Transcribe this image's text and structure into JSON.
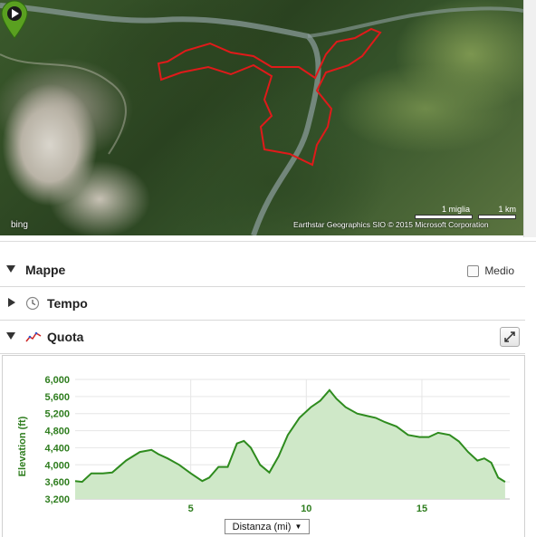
{
  "map": {
    "attribution": "Earthstar Geographics SIO   © 2015 Microsoft Corporation",
    "bing_logo": "bing",
    "scale_mi": "1 miglia",
    "scale_km": "1 km",
    "route_color": "#e01a1a",
    "marker_color": "#5aa020",
    "marker_icon": "play-icon"
  },
  "panels": {
    "mappe": {
      "title": "Mappe",
      "checkbox_label": "Medio",
      "checked": false
    },
    "tempo": {
      "title": "Tempo",
      "icon": "clock-icon"
    },
    "quota": {
      "title": "Quota",
      "icon": "elevation-chart-icon"
    }
  },
  "chart_data": {
    "type": "area",
    "ylabel": "Elevation (ft)",
    "ylim": [
      3200,
      6000
    ],
    "yticks": [
      "6,000",
      "5,600",
      "5,200",
      "4,800",
      "4,400",
      "4,000",
      "3,600",
      "3,200"
    ],
    "xlim": [
      0,
      18.8
    ],
    "xticks": [
      "5",
      "10",
      "15"
    ],
    "xtick_values": [
      5,
      10,
      15
    ],
    "line_color": "#2e8b1e",
    "fill_color": "#cfe8c8",
    "x": [
      0,
      0.3,
      0.7,
      1.2,
      1.6,
      2.2,
      2.8,
      3.3,
      3.6,
      4.0,
      4.5,
      5.0,
      5.5,
      5.8,
      6.2,
      6.6,
      7.0,
      7.3,
      7.6,
      8.0,
      8.4,
      8.8,
      9.2,
      9.7,
      10.2,
      10.6,
      11.0,
      11.3,
      11.7,
      12.2,
      12.6,
      13.0,
      13.4,
      13.9,
      14.4,
      14.9,
      15.3,
      15.7,
      16.2,
      16.6,
      17.0,
      17.4,
      17.7,
      18.0,
      18.3,
      18.6
    ],
    "y": [
      3620,
      3600,
      3800,
      3800,
      3820,
      4100,
      4300,
      4350,
      4250,
      4150,
      4000,
      3800,
      3620,
      3700,
      3950,
      3950,
      4500,
      4560,
      4400,
      4000,
      3820,
      4200,
      4700,
      5100,
      5350,
      5500,
      5750,
      5550,
      5350,
      5200,
      5150,
      5100,
      5000,
      4900,
      4700,
      4650,
      4650,
      4750,
      4700,
      4550,
      4300,
      4100,
      4150,
      4050,
      3700,
      3600
    ]
  },
  "controls": {
    "distance_select": "Distanza (mi)"
  }
}
